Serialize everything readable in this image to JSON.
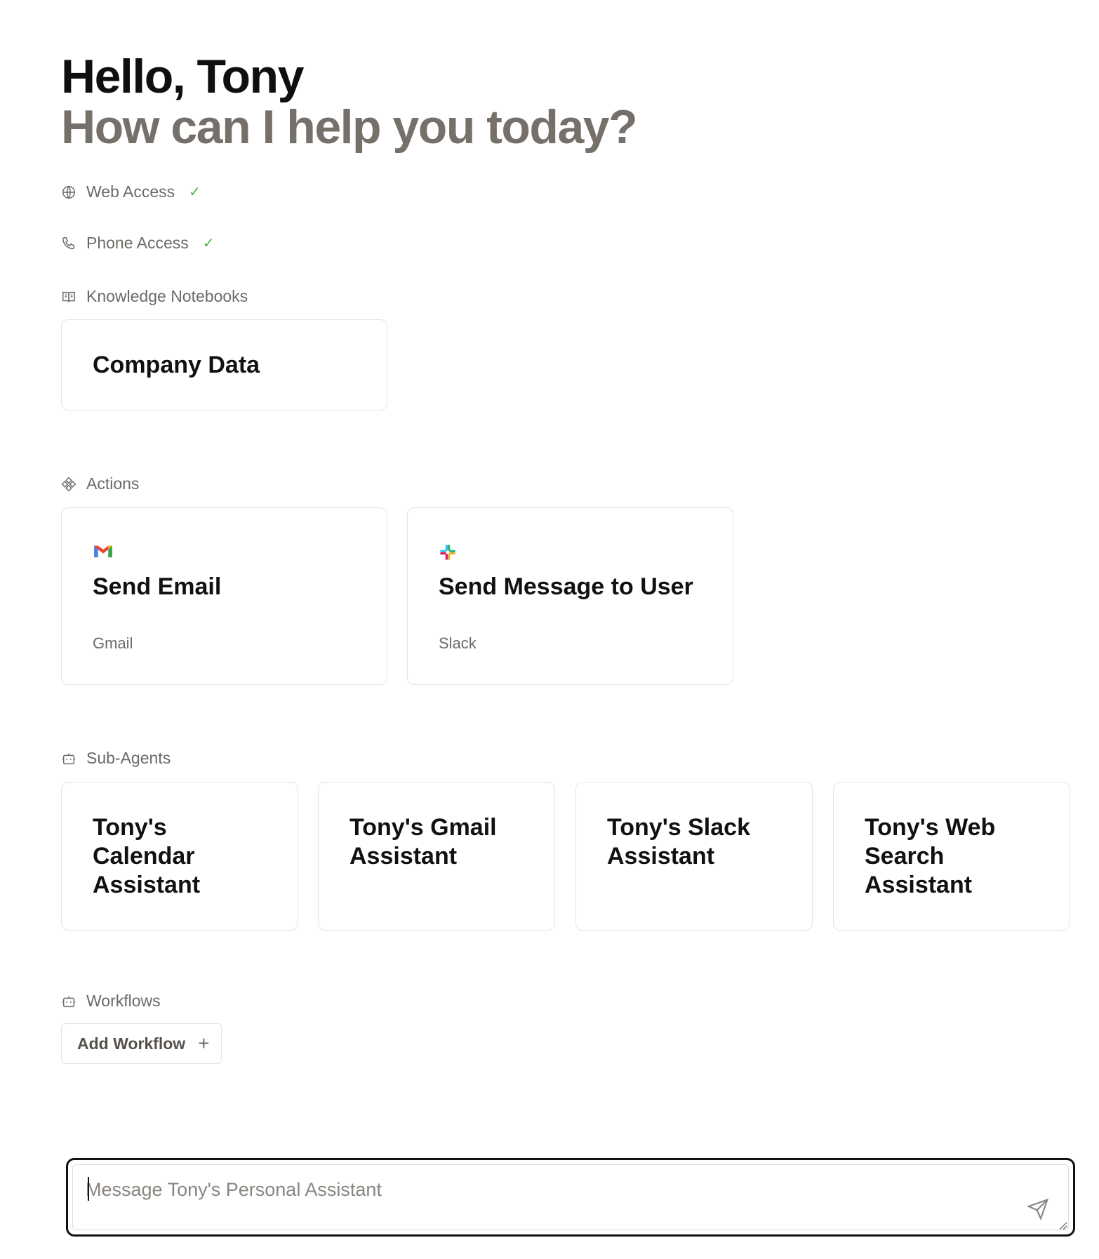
{
  "header": {
    "greeting": "Hello, Tony",
    "subtitle": "How can I help you today?"
  },
  "capabilities": [
    {
      "label": "Web Access",
      "icon": "globe-icon",
      "enabled": true
    },
    {
      "label": "Phone Access",
      "icon": "phone-icon",
      "enabled": true
    }
  ],
  "check_mark": "✓",
  "knowledge": {
    "label": "Knowledge Notebooks",
    "icon": "book-icon",
    "items": [
      {
        "title": "Company Data"
      }
    ]
  },
  "actions": {
    "label": "Actions",
    "icon": "actions-icon",
    "items": [
      {
        "title": "Send Email",
        "provider": "Gmail",
        "icon": "gmail-icon"
      },
      {
        "title": "Send Message to User",
        "provider": "Slack",
        "icon": "slack-icon"
      }
    ]
  },
  "subagents": {
    "label": "Sub-Agents",
    "icon": "bot-icon",
    "items": [
      {
        "title": "Tony's Calendar Assistant"
      },
      {
        "title": "Tony's Gmail Assistant"
      },
      {
        "title": "Tony's Slack Assistant"
      },
      {
        "title": "Tony's Web Search Assistant"
      }
    ]
  },
  "workflows": {
    "label": "Workflows",
    "icon": "bot-icon",
    "add_label": "Add Workflow",
    "add_icon": "+"
  },
  "composer": {
    "placeholder": "Message Tony's Personal Assistant",
    "send_icon": "send-icon"
  },
  "colors": {
    "check": "#4caf50",
    "muted_text": "#6d6a66",
    "subtitle": "#76706b"
  }
}
